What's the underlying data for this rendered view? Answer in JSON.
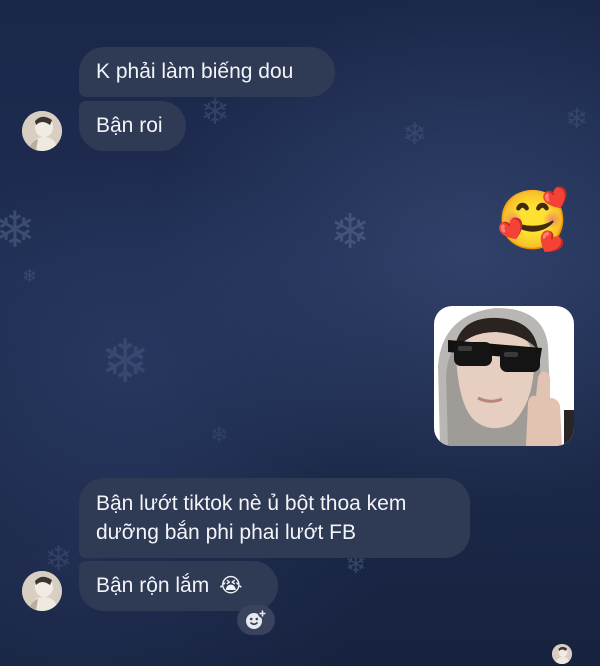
{
  "chat": {
    "messages": [
      {
        "sender": "other",
        "text": "K phải làm biếng dou"
      },
      {
        "sender": "other",
        "text": "Bận roi"
      },
      {
        "sender": "me",
        "emoji": "🥰"
      },
      {
        "sender": "me",
        "photo": "photo of a person wearing sunglasses and a hood"
      },
      {
        "sender": "other",
        "text_line1": "Bận lướt tiktok nè ủ bột thoa kem",
        "text_line2": "dưỡng bắn phi phai lướt FB"
      },
      {
        "sender": "other",
        "text": "Bận rộn lắm",
        "emoji": "😭"
      }
    ]
  },
  "colors": {
    "background": "#1c2a4d",
    "bubble_incoming": "#2f3a55",
    "bubble_text": "#f2f4f8"
  },
  "icons": {
    "reaction": "add-reaction-icon",
    "snowflake": "snowflake-icon"
  }
}
